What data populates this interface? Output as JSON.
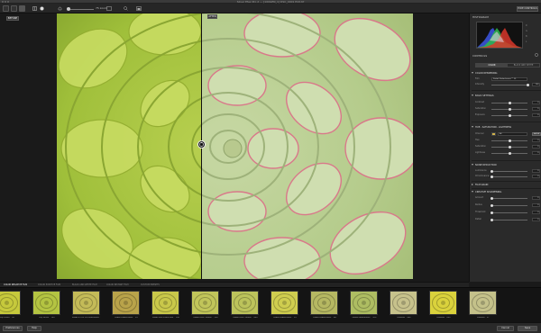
{
  "window": {
    "title": "Silver Efex Pro 2 — [100GEN_1] DSC_0001 Edit.tif"
  },
  "toolbar": {
    "zoom_label": "75 zoom",
    "hide_controls_label": "HIDE CONTROLS"
  },
  "canvas": {
    "before_label": "BEFORE",
    "after_label": "AFTER"
  },
  "panel": {
    "histogram_title": "HISTOGRAM",
    "histogram_legend": [
      "R",
      "G",
      "B",
      "L"
    ],
    "controls_title": "CONTROLS",
    "tabs": [
      "COLOR",
      "BLACK AND WHITE"
    ],
    "color_rendering": {
      "title": "COLOR RENDERING",
      "film_label": "Film",
      "film_value": "Kodak Kodachrome™ 25",
      "intensity_label": "Intensity",
      "intensity_value": "100",
      "intensity_fraction": 1.0
    },
    "basic_settings": {
      "title": "BASIC SETTINGS",
      "rows": [
        {
          "label": "Contrast",
          "value": "0",
          "fraction": 0.5
        },
        {
          "label": "Saturation",
          "value": "0",
          "fraction": 0.5
        },
        {
          "label": "Exposure",
          "value": "0",
          "fraction": 0.5
        }
      ]
    },
    "hue_sat": {
      "title": "HUE - SATURATION - LIGHTNESS",
      "channel_label": "Channel",
      "channel_value": "All",
      "reset_label": "SHOW",
      "rows": [
        {
          "label": "Hue",
          "value": "0",
          "fraction": 0.5
        },
        {
          "label": "Saturation",
          "value": "0",
          "fraction": 0.5
        },
        {
          "label": "Lightness",
          "value": "0",
          "fraction": 0.5
        }
      ]
    },
    "grain": {
      "title": "NOISE REDUCTION",
      "rows": [
        {
          "label": "Luminance",
          "value": "0",
          "fraction": 0.0
        },
        {
          "label": "Chrominance",
          "value": "0",
          "fraction": 0.0
        }
      ]
    },
    "film_grain": {
      "title": "FILM GRAIN"
    },
    "creative": {
      "title": "CREATIVE SHARPENING",
      "rows": [
        {
          "label": "Amount",
          "value": "0",
          "fraction": 0.0
        },
        {
          "label": "Radius",
          "value": "0",
          "fraction": 0.0
        },
        {
          "label": "Threshold",
          "value": "0",
          "fraction": 0.0
        },
        {
          "label": "Detail",
          "value": "0",
          "fraction": 0.0
        }
      ]
    }
  },
  "filmstrip": {
    "tabs": [
      "COLOR NEGATIVE FILM",
      "COLOR POSITIVE FILM",
      "BLACK AND WHITE FILM",
      "COLOR INSTANT FILM",
      "CUSTOM PRESETS"
    ],
    "active_tab": 0,
    "items": [
      {
        "label": "Fuji Velvia™ 50",
        "tint": "#c6c93c"
      },
      {
        "label": "Fuji Velvia™ 100",
        "tint": "#b4c442"
      },
      {
        "label": "Kodak E-100 GX Ektachrome™",
        "tint": "#c4bb58"
      },
      {
        "label": "Kodak Kodachrome™ 25",
        "tint": "#b9a34a"
      },
      {
        "label": "Kodak Elite ExtraColor™ 100",
        "tint": "#c9c84a"
      },
      {
        "label": "Kodak Elite Chrome™ 200",
        "tint": "#c1c55a"
      },
      {
        "label": "Kodak Elite Chrome™ 400",
        "tint": "#bcc35b"
      },
      {
        "label": "Kodak Kodachrome™ 25",
        "tint": "#cfcd4f"
      },
      {
        "label": "Kodak Kodachrome™ 64",
        "tint": "#b6b862"
      },
      {
        "label": "Kodak Kodachrome™ 200",
        "tint": "#aebd62"
      },
      {
        "label": "Polaroid™ 669",
        "tint": "#c7c28c"
      },
      {
        "label": "Polaroid™ 690",
        "tint": "#dad23c"
      },
      {
        "label": "Polaroid™ 4..",
        "tint": "#c4c18a"
      }
    ]
  },
  "bottom": {
    "preferences_label": "Preferences",
    "help_label": "Help",
    "cancel_label": "Cancel",
    "save_label": "Save"
  }
}
